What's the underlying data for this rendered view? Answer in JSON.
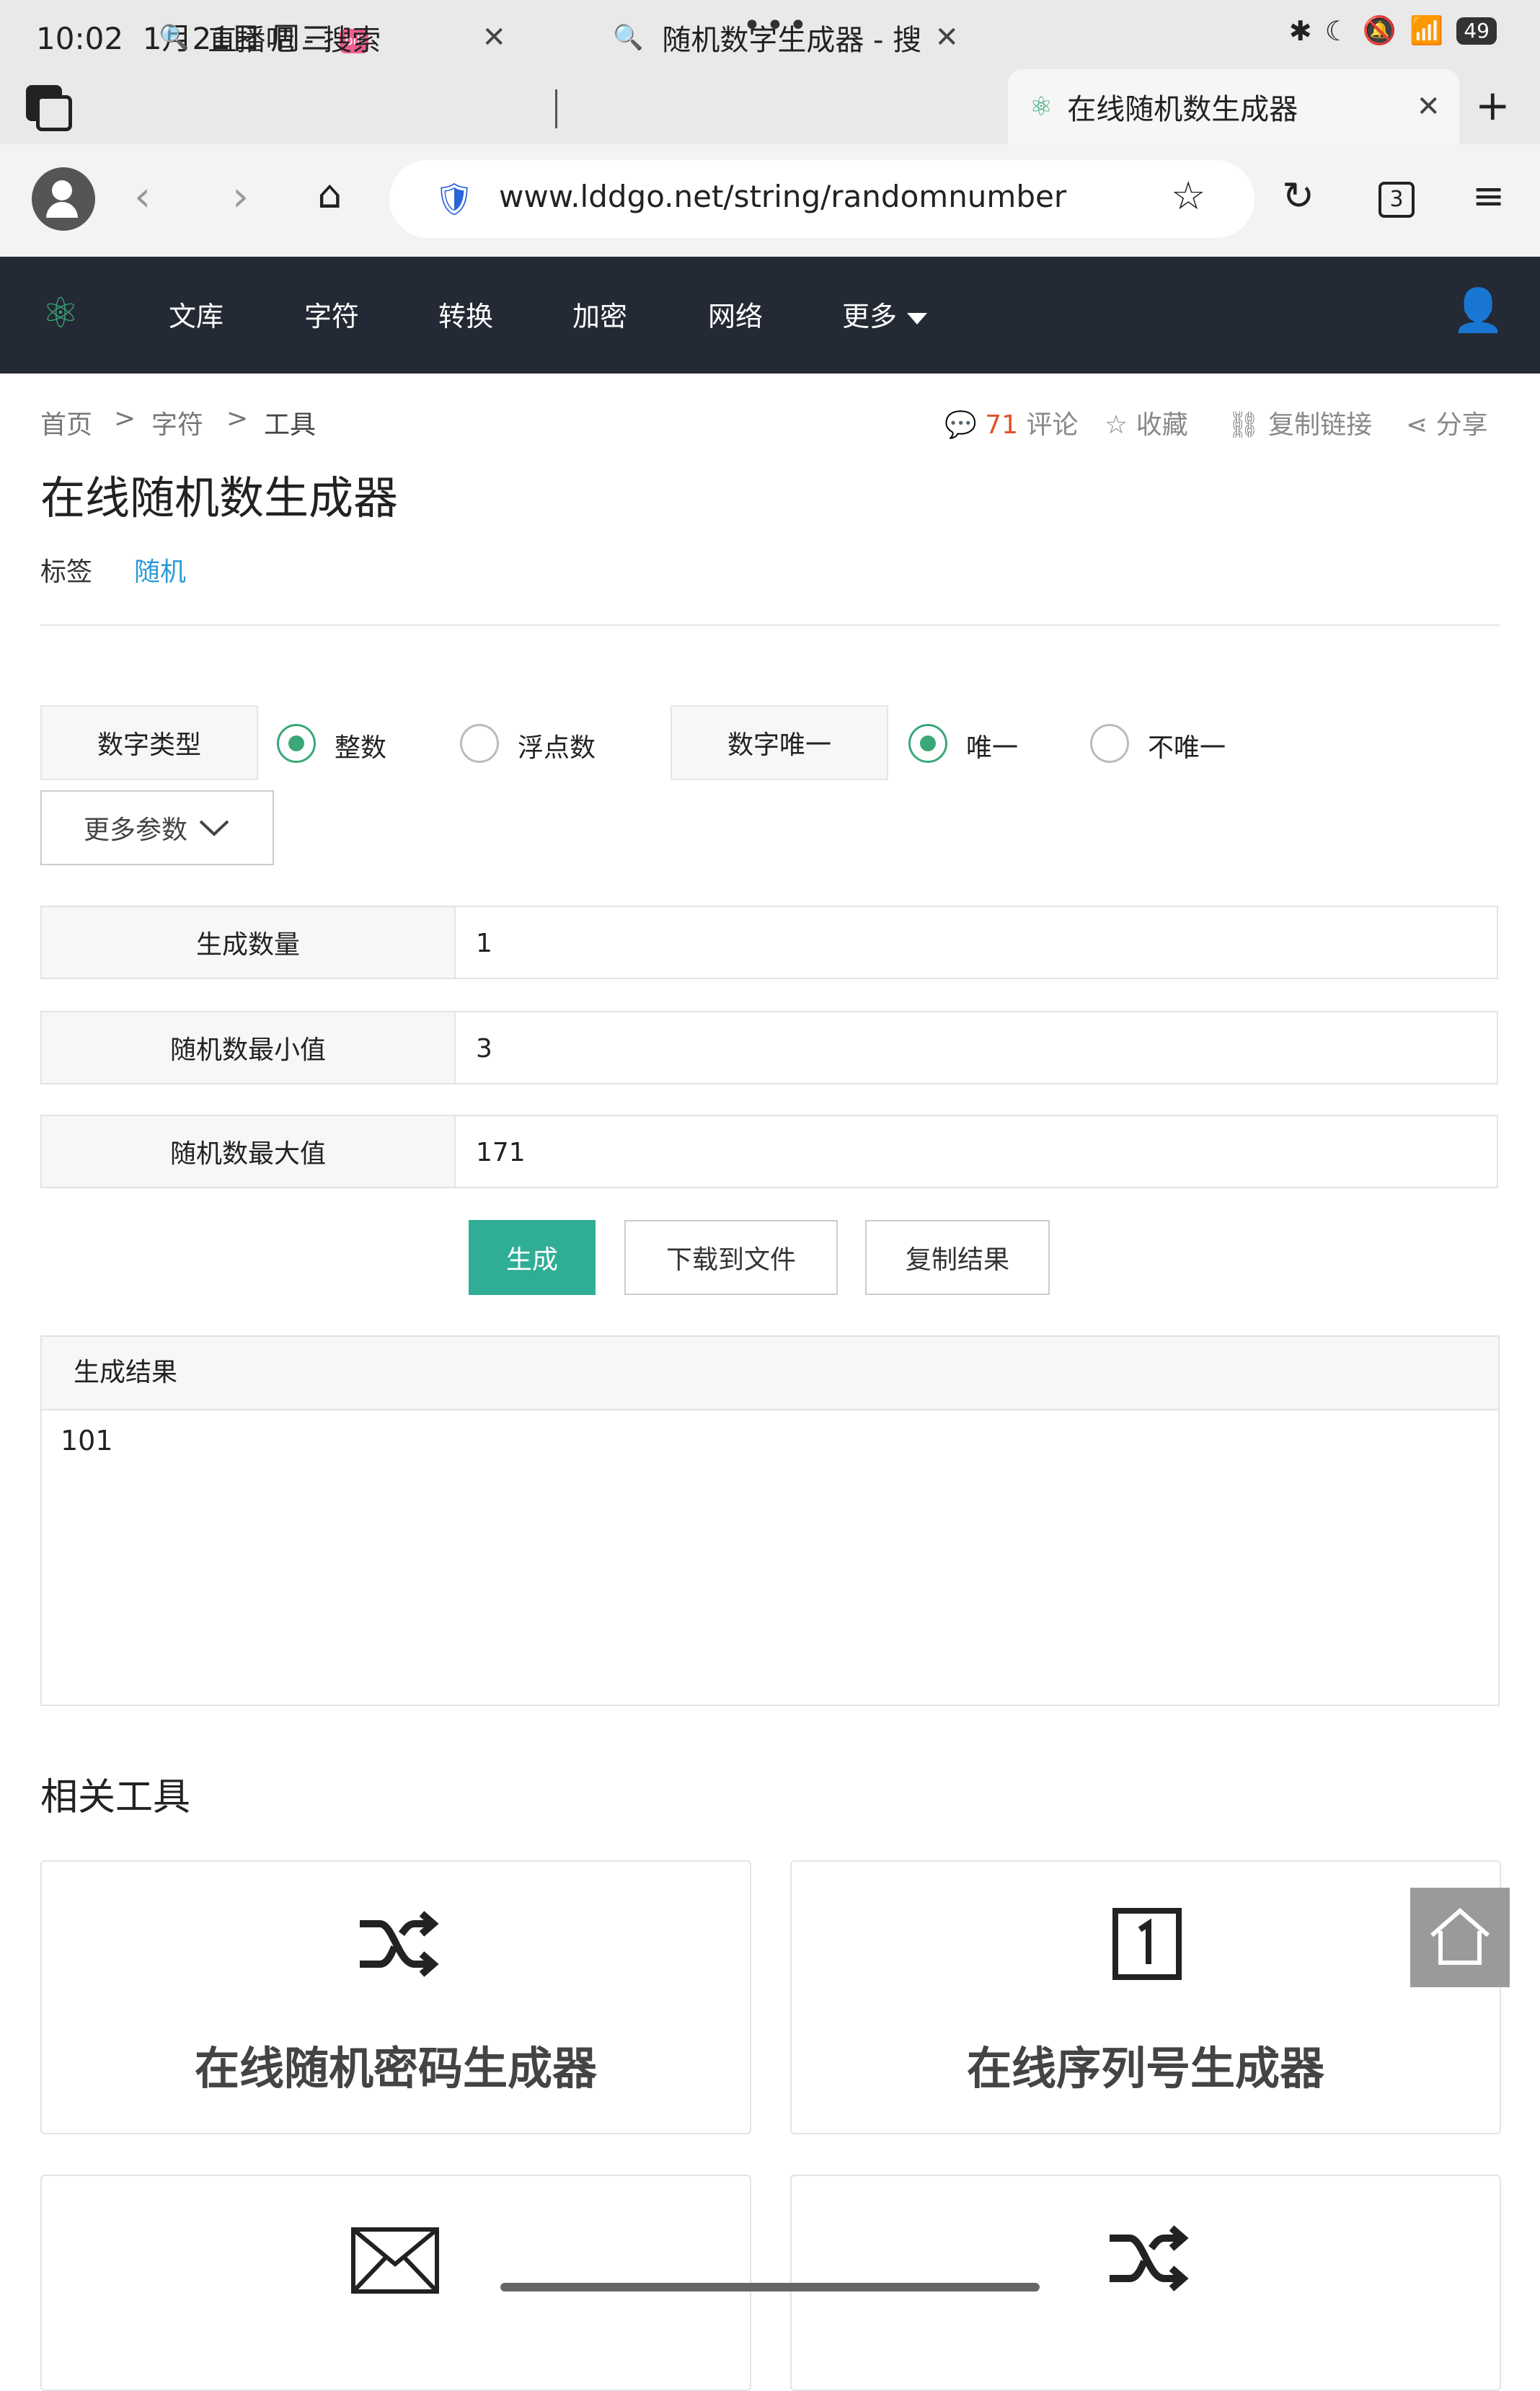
{
  "status": {
    "time": "10:02",
    "date": "1月21日 周三",
    "app_badge": "bili",
    "battery": "49",
    "dots": "•••"
  },
  "tabs": [
    {
      "label": "直播吧 - 搜索"
    },
    {
      "label": "随机数字生成器 - 搜"
    },
    {
      "label": "在线随机数生成器"
    }
  ],
  "toolbar": {
    "url": "www.lddgo.net/string/randomnumber",
    "tab_count": "3"
  },
  "site_nav": {
    "items": [
      "文库",
      "字符",
      "转换",
      "加密",
      "网络",
      "更多"
    ]
  },
  "breadcrumb": {
    "home": "首页",
    "sep": ">",
    "level1": "字符",
    "level2": "工具"
  },
  "actions": {
    "comment_count": "71",
    "comment": "评论",
    "favorite": "收藏",
    "copy_link": "复制链接",
    "share": "分享"
  },
  "page": {
    "title": "在线随机数生成器",
    "tag_label": "标签",
    "tag_value": "随机"
  },
  "options": {
    "type_label": "数字类型",
    "integer": "整数",
    "float": "浮点数",
    "unique_label": "数字唯一",
    "unique": "唯一",
    "not_unique": "不唯一",
    "more_params": "更多参数"
  },
  "fields": [
    {
      "label": "生成数量",
      "value": "1"
    },
    {
      "label": "随机数最小值",
      "value": "3"
    },
    {
      "label": "随机数最大值",
      "value": "171"
    }
  ],
  "buttons": {
    "generate": "生成",
    "download": "下载到文件",
    "copy": "复制结果"
  },
  "result": {
    "title": "生成结果",
    "value": "101"
  },
  "related": {
    "title": "相关工具",
    "cards": [
      {
        "label": "在线随机密码生成器",
        "icon": "shuffle-icon"
      },
      {
        "label": "在线序列号生成器",
        "icon": "number-one-box-icon"
      }
    ]
  },
  "colors": {
    "nav_bg": "#232a35",
    "accent": "#2fae95",
    "radio": "#3aa776",
    "tag": "#2b9ad6"
  }
}
